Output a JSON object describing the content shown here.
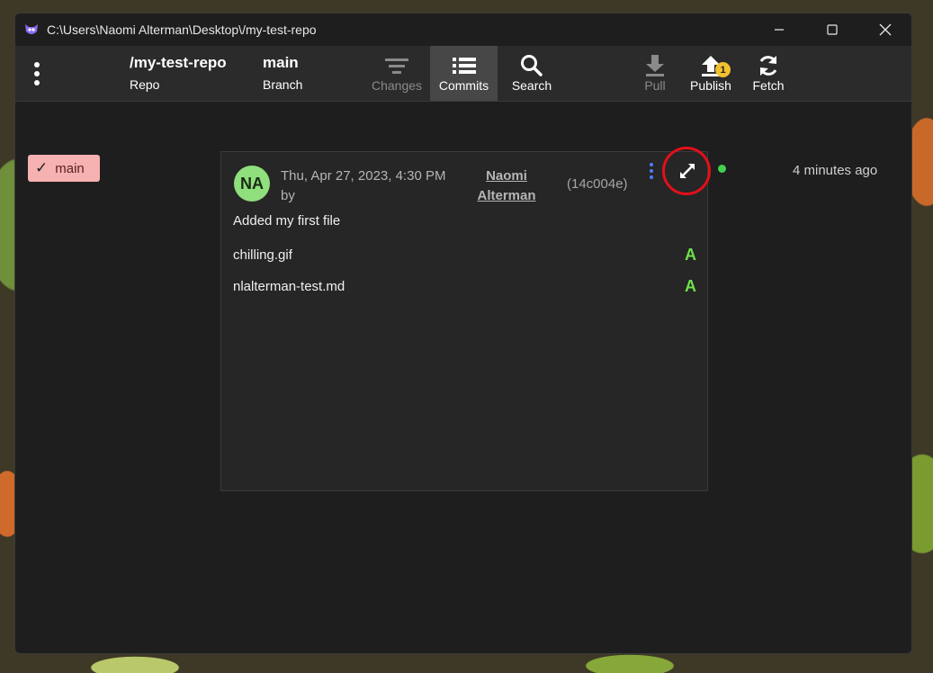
{
  "window": {
    "title": "C:\\Users\\Naomi Alterman\\Desktop\\/my-test-repo"
  },
  "toolbar": {
    "repo_name": "/my-test-repo",
    "repo_caption": "Repo",
    "branch_name": "main",
    "branch_caption": "Branch",
    "changes_label": "Changes",
    "commits_label": "Commits",
    "search_label": "Search",
    "pull_label": "Pull",
    "publish_label": "Publish",
    "publish_badge": "1",
    "fetch_label": "Fetch"
  },
  "branch_tag": {
    "check": "✓",
    "label": "main"
  },
  "commit": {
    "avatar_initials": "NA",
    "date_line1": "Thu, Apr 27, 2023, 4:30 PM",
    "date_line2": "by",
    "author_line1": "Naomi",
    "author_line2": "Alterman",
    "hash": "(14c004e)",
    "message": "Added my first file",
    "files": [
      {
        "name": "chilling.gif",
        "status": "A"
      },
      {
        "name": "nlalterman-test.md",
        "status": "A"
      }
    ],
    "relative_time": "4 minutes ago"
  },
  "colors": {
    "active_tab_bg": "#474747",
    "branch_tag_bg": "#f6b1b1",
    "avatar_bg": "#8fe07d",
    "added_status": "#6ee04a",
    "badge": "#f2c12e",
    "status_dot": "#43d04d",
    "highlight_ring": "#e3101a",
    "kebab": "#4f7cff"
  }
}
